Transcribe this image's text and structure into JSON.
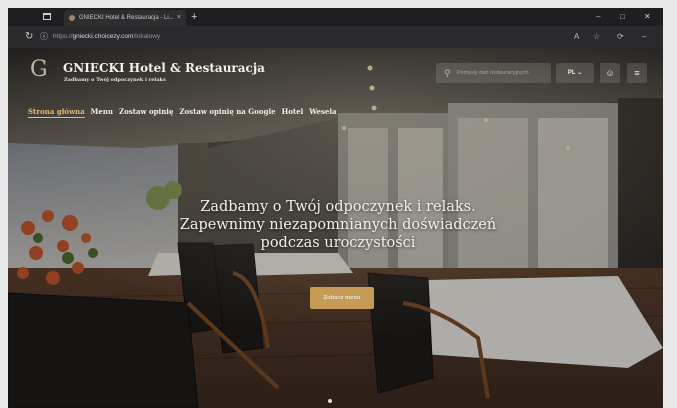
{
  "browser": {
    "tab_title": "GNIECKI Hotel & Restauracja - Li...",
    "tab_close": "×",
    "new_tab": "+",
    "url_scheme": "https://",
    "url_host": "gniecki.choicezy.com",
    "url_path": "/lokalowy",
    "win_min": "–",
    "win_max": "□",
    "win_close": "✕"
  },
  "site": {
    "logo_letter": "G",
    "brand": "GNIECKI Hotel & Restauracja",
    "tagline": "Zadbamy o Twój odpoczynek i relaks",
    "search_placeholder": "Pomysły dań restauracyjnych",
    "language": "PL",
    "nav": [
      "Strona główna",
      "Menu",
      "Zostaw opinię",
      "Zostaw opinię na Google",
      "Hotel",
      "Wesela"
    ]
  },
  "hero": {
    "line1": "Zadbamy o Twój odpoczynek i relaks.",
    "line2": "Zapewnimy niezapomnianych doświadczeń",
    "line3": "podczas uroczystości",
    "cta": "Zobacz menu"
  },
  "colors": {
    "accent": "#c59b55",
    "active_nav": "#e1b97a",
    "browser_chrome": "#1f1f22"
  },
  "icons": [
    "window-icon",
    "favicon-icon",
    "reload-icon",
    "info-icon",
    "read-aloud-icon",
    "favorite-icon",
    "extensions-icon",
    "more-icon",
    "search-icon",
    "chevron-down-icon",
    "user-icon",
    "hamburger-menu-icon"
  ]
}
